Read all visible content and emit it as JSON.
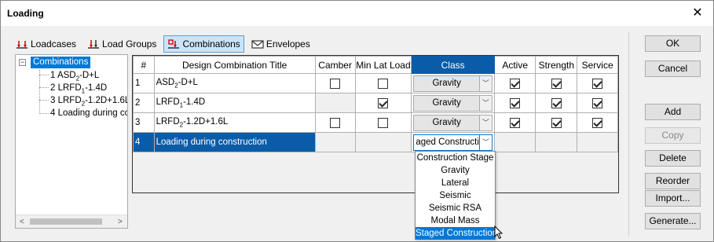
{
  "window": {
    "title": "Loading"
  },
  "tabs": [
    {
      "label": "Loadcases",
      "icon": "loadcases-icon"
    },
    {
      "label": "Load Groups",
      "icon": "load-groups-icon"
    },
    {
      "label": "Combinations",
      "icon": "combinations-icon",
      "active": true
    },
    {
      "label": "Envelopes",
      "icon": "envelopes-icon"
    }
  ],
  "tree": {
    "root": "Combinations",
    "items": [
      {
        "number": "1",
        "prefix": "ASD",
        "sub": "2",
        "suffix": "-D+L"
      },
      {
        "number": "2",
        "prefix": "LRFD",
        "sub": "1",
        "suffix": "-1.4D"
      },
      {
        "number": "3",
        "prefix": "LRFD",
        "sub": "2",
        "suffix": "-1.2D+1.6L"
      },
      {
        "number": "4",
        "prefix": "Loading during cc",
        "sub": "",
        "suffix": ""
      }
    ]
  },
  "grid": {
    "headers": [
      "#",
      "Design Combination Title",
      "Camber",
      "Min Lat Load",
      "Class",
      "Active",
      "Strength",
      "Service"
    ],
    "rows": [
      {
        "num": "1",
        "title_prefix": "ASD",
        "title_sub": "2",
        "title_suffix": "-D+L",
        "camber": false,
        "minlat": false,
        "class": "Gravity",
        "active": true,
        "strength": true,
        "service": true
      },
      {
        "num": "2",
        "title_prefix": "LRFD",
        "title_sub": "1",
        "title_suffix": "-1.4D",
        "camber": null,
        "minlat": true,
        "class": "Gravity",
        "active": true,
        "strength": true,
        "service": true
      },
      {
        "num": "3",
        "title_prefix": "LRFD",
        "title_sub": "2",
        "title_suffix": "-1.2D+1.6L",
        "camber": false,
        "minlat": false,
        "class": "Gravity",
        "active": true,
        "strength": true,
        "service": true
      },
      {
        "num": "4",
        "title_prefix": "Loading during construction",
        "title_sub": "",
        "title_suffix": "",
        "class": "aged Constructi"
      }
    ]
  },
  "class_options": [
    "Construction Stage",
    "Gravity",
    "Lateral",
    "Seismic",
    "Seismic RSA",
    "Modal Mass",
    "Staged Construction"
  ],
  "class_selected": "Staged Construction",
  "buttons": {
    "ok": "OK",
    "cancel": "Cancel",
    "add": "Add",
    "copy": "Copy",
    "delete": "Delete",
    "reorder": "Reorder",
    "import": "Import...",
    "generate": "Generate..."
  },
  "colors": {
    "selection": "#0078d7",
    "header_selected": "#0b5ca8"
  }
}
